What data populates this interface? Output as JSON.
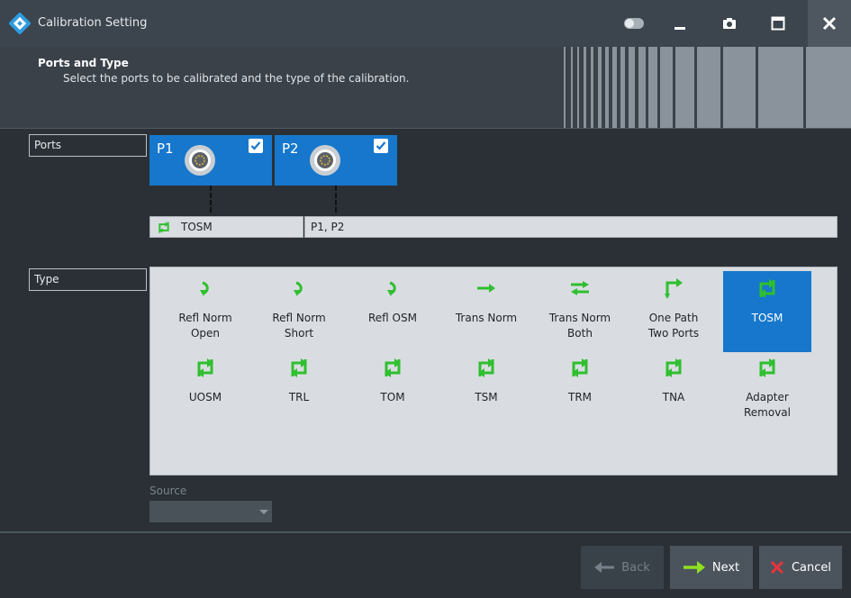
{
  "window": {
    "title": "Calibration Setting"
  },
  "header": {
    "title": "Ports and Type",
    "subtitle": "Select the ports to be calibrated and the type of the calibration."
  },
  "ports_section": {
    "label": "Ports",
    "ports": [
      {
        "label": "P1",
        "checked": true
      },
      {
        "label": "P2",
        "checked": true
      }
    ],
    "summary": {
      "type": "TOSM",
      "ports": "P1, P2"
    }
  },
  "type_section": {
    "label": "Type",
    "options": [
      {
        "label": "Refl Norm\nOpen",
        "icon": "refl-icon",
        "selected": false
      },
      {
        "label": "Refl Norm\nShort",
        "icon": "refl-icon",
        "selected": false
      },
      {
        "label": "Refl OSM",
        "icon": "refl-icon",
        "selected": false
      },
      {
        "label": "Trans Norm",
        "icon": "trans-icon",
        "selected": false
      },
      {
        "label": "Trans Norm\nBoth",
        "icon": "trans-both-icon",
        "selected": false
      },
      {
        "label": "One Path\nTwo Ports",
        "icon": "one-path-icon",
        "selected": false
      },
      {
        "label": "TOSM",
        "icon": "full-2port-icon",
        "selected": true
      },
      {
        "label": "UOSM",
        "icon": "full-2port-icon",
        "selected": false
      },
      {
        "label": "TRL",
        "icon": "full-2port-icon",
        "selected": false
      },
      {
        "label": "TOM",
        "icon": "full-2port-icon",
        "selected": false
      },
      {
        "label": "TSM",
        "icon": "full-2port-icon",
        "selected": false
      },
      {
        "label": "TRM",
        "icon": "full-2port-icon",
        "selected": false
      },
      {
        "label": "TNA",
        "icon": "full-2port-icon",
        "selected": false
      },
      {
        "label": "Adapter\nRemoval",
        "icon": "full-2port-icon",
        "selected": false
      }
    ]
  },
  "source": {
    "label": "Source",
    "value": ""
  },
  "buttons": {
    "back": "Back",
    "next": "Next",
    "cancel": "Cancel"
  },
  "colors": {
    "accent": "#1677cc",
    "icon_green": "#2fbf2f",
    "cancel_red": "#e8343a"
  }
}
